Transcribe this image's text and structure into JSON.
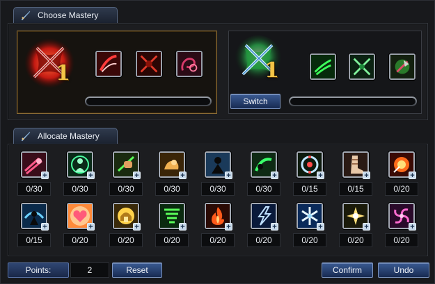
{
  "sections": {
    "choose_title": "Choose Mastery",
    "allocate_title": "Allocate Mastery"
  },
  "mastery_1": {
    "level": "1",
    "emblem": "red-crossed-swords-emblem",
    "skills": [
      "red-slash-skill-icon",
      "red-crossed-blades-skill-icon",
      "red-chain-skill-icon"
    ]
  },
  "mastery_2": {
    "level": "1",
    "emblem": "green-crossed-swords-emblem",
    "skills": [
      "green-claw-skill-icon",
      "green-crossed-blades-skill-icon",
      "green-axe-skill-icon"
    ],
    "switch_label": "Switch"
  },
  "allocate": {
    "row1": [
      {
        "icon": "dash-icon",
        "count": "0/30"
      },
      {
        "icon": "body-aura-icon",
        "count": "0/30"
      },
      {
        "icon": "fist-icon",
        "count": "0/30"
      },
      {
        "icon": "strength-arm-icon",
        "count": "0/30"
      },
      {
        "icon": "shadow-figure-icon",
        "count": "0/30"
      },
      {
        "icon": "leap-icon",
        "count": "0/30"
      },
      {
        "icon": "target-ring-icon",
        "count": "0/15"
      },
      {
        "icon": "boot-icon",
        "count": "0/15"
      },
      {
        "icon": "fire-burst-icon",
        "count": "0/20"
      }
    ],
    "row2": [
      {
        "icon": "vortex-figure-icon",
        "count": "0/15"
      },
      {
        "icon": "heart-icon",
        "count": "0/20"
      },
      {
        "icon": "golden-helm-icon",
        "count": "0/20"
      },
      {
        "icon": "whirlwind-icon",
        "count": "0/20"
      },
      {
        "icon": "flame-icon",
        "count": "0/20"
      },
      {
        "icon": "lightning-icon",
        "count": "0/20"
      },
      {
        "icon": "snowflake-icon",
        "count": "0/20"
      },
      {
        "icon": "star-burst-icon",
        "count": "0/20"
      },
      {
        "icon": "pink-swirl-icon",
        "count": "0/20"
      }
    ]
  },
  "footer": {
    "points_label": "Points:",
    "points_value": "2",
    "reset_label": "Reset",
    "confirm_label": "Confirm",
    "undo_label": "Undo"
  },
  "colors": {
    "accent": "#2a4a85",
    "selected_border": "#8a6b34"
  }
}
